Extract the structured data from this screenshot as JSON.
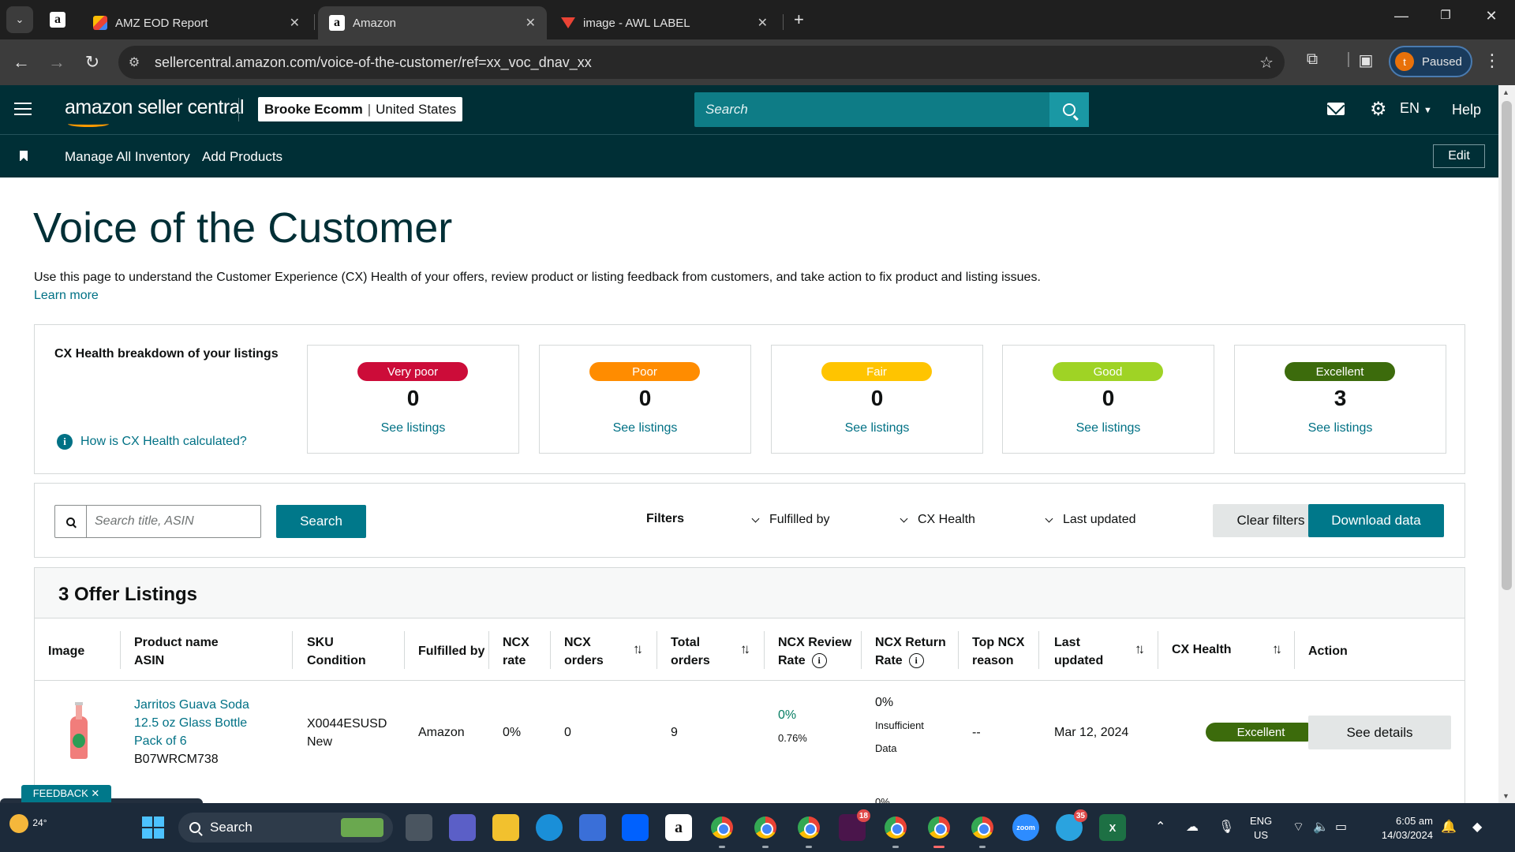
{
  "browser": {
    "tabs": [
      {
        "title": "AMZ EOD Report"
      },
      {
        "title": "Amazon"
      },
      {
        "title": "image - AWL LABEL"
      }
    ],
    "url": "sellercentral.amazon.com/voice-of-the-customer/ref=xx_voc_dnav_xx",
    "profile_initial": "t",
    "profile_status": "Paused"
  },
  "header": {
    "logo_text": "amazon seller central",
    "account_name": "Brooke Ecomm",
    "account_region": "United States",
    "search_placeholder": "Search",
    "language": "EN",
    "help": "Help"
  },
  "subnav": {
    "links": [
      "Manage All Inventory",
      "Add Products"
    ],
    "edit": "Edit"
  },
  "page": {
    "title": "Voice of the Customer",
    "intro": "Use this page to understand the Customer Experience (CX) Health of your offers, review product or listing feedback from customers, and take action to fix product and listing issues.",
    "learn_more": "Learn more"
  },
  "cx_health": {
    "title": "CX Health breakdown of your listings",
    "how_link": "How is CX Health calculated?",
    "cards": [
      {
        "label": "Very poor",
        "count": "0",
        "link": "See listings",
        "color": "#cc0c39"
      },
      {
        "label": "Poor",
        "count": "0",
        "link": "See listings",
        "color": "#ff8c00"
      },
      {
        "label": "Fair",
        "count": "0",
        "link": "See listings",
        "color": "#ffc400"
      },
      {
        "label": "Good",
        "count": "0",
        "link": "See listings",
        "color": "#9fd325"
      },
      {
        "label": "Excellent",
        "count": "3",
        "link": "See listings",
        "color": "#3c6b0c"
      }
    ]
  },
  "filters": {
    "search_placeholder": "Search title, ASIN",
    "search_button": "Search",
    "label": "Filters",
    "dropdowns": [
      "Fulfilled by",
      "CX Health",
      "Last updated"
    ],
    "clear": "Clear filters",
    "download": "Download data"
  },
  "listings": {
    "title": "3 Offer Listings",
    "columns": {
      "image": "Image",
      "product_name": "Product name",
      "asin": "ASIN",
      "sku": "SKU",
      "condition": "Condition",
      "fulfilled_by": "Fulfilled by",
      "ncx_rate_1": "NCX",
      "ncx_rate_2": "rate",
      "ncx_orders_1": "NCX",
      "ncx_orders_2": "orders",
      "total_orders_1": "Total",
      "total_orders_2": "orders",
      "review_rate_1": "NCX Review",
      "review_rate_2": "Rate",
      "return_rate_1": "NCX Return",
      "return_rate_2": "Rate",
      "top_reason_1": "Top NCX",
      "top_reason_2": "reason",
      "last_updated_1": "Last",
      "last_updated_2": "updated",
      "cx_health": "CX Health",
      "action": "Action"
    },
    "rows": [
      {
        "name_line1": "Jarritos Guava Soda",
        "name_line2": "12.5 oz Glass Bottle",
        "name_line3": "Pack of 6",
        "asin": "B07WRCM738",
        "sku": "X0044ESUSD",
        "condition": "New",
        "fulfilled_by": "Amazon",
        "ncx_rate": "0%",
        "ncx_orders": "0",
        "total_orders": "9",
        "review_rate": "0%",
        "review_rate_sub": "0.76%",
        "return_rate": "0%",
        "return_rate_sub1": "Insufficient",
        "return_rate_sub2": "Data",
        "top_reason": "--",
        "last_updated": "Mar 12, 2024",
        "cx_health": "Excellent",
        "action": "See details"
      }
    ],
    "next_row_peek": "0%"
  },
  "feedback": "FEEDBACK ✕",
  "taskbar": {
    "weather": "24°",
    "search": "Search",
    "lang_1": "ENG",
    "lang_2": "US",
    "time": "6:05 am",
    "date": "14/03/2024"
  }
}
